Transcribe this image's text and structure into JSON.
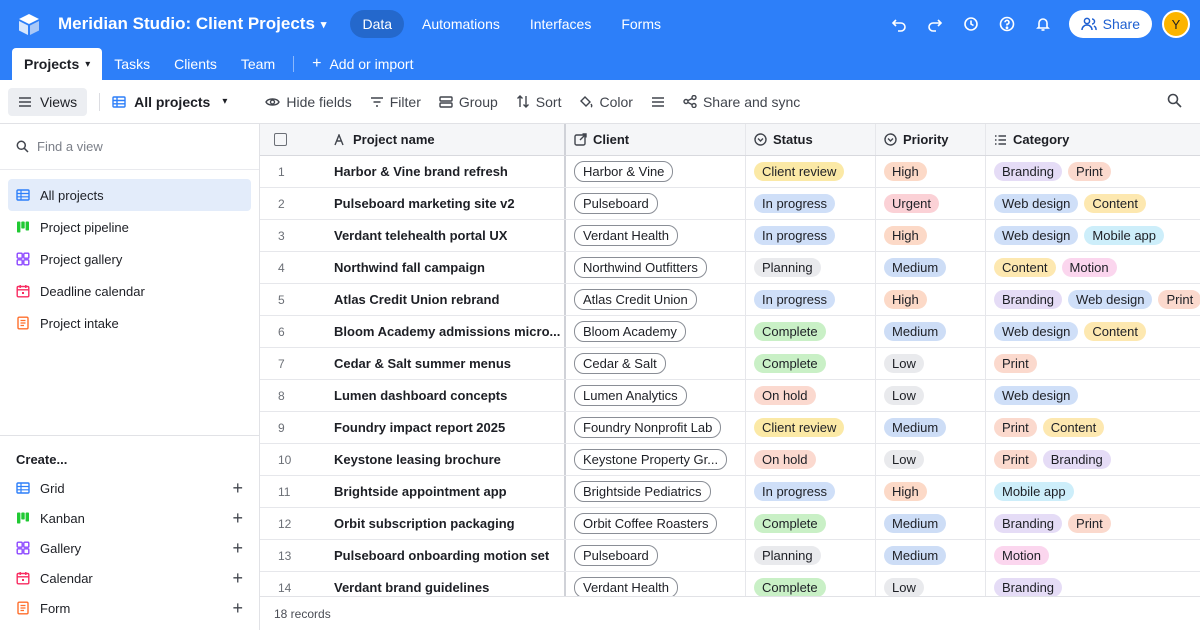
{
  "app": {
    "base_title": "Meridian Studio: Client Projects",
    "nav": [
      "Data",
      "Automations",
      "Interfaces",
      "Forms"
    ],
    "share_label": "Share",
    "avatar_initial": "Y",
    "brand_color": "#2d7ff9"
  },
  "tables": {
    "items": [
      "Projects",
      "Tasks",
      "Clients",
      "Team"
    ],
    "add_label": "Add or import"
  },
  "viewbar": {
    "views_label": "Views",
    "current_view": "All projects",
    "tools": [
      "Hide fields",
      "Filter",
      "Group",
      "Sort",
      "Color",
      "Share and sync"
    ]
  },
  "sidebar": {
    "find_placeholder": "Find a view",
    "views": [
      {
        "label": "All projects",
        "icon": "grid-view-icon"
      },
      {
        "label": "Project pipeline",
        "icon": "kanban-view-icon"
      },
      {
        "label": "Project gallery",
        "icon": "gallery-view-icon"
      },
      {
        "label": "Deadline calendar",
        "icon": "calendar-view-icon"
      },
      {
        "label": "Project intake",
        "icon": "form-view-icon"
      }
    ],
    "create_title": "Create...",
    "create_items": [
      {
        "label": "Grid",
        "icon": "grid-view-icon"
      },
      {
        "label": "Kanban",
        "icon": "kanban-view-icon"
      },
      {
        "label": "Gallery",
        "icon": "gallery-view-icon"
      },
      {
        "label": "Calendar",
        "icon": "calendar-view-icon"
      },
      {
        "label": "Form",
        "icon": "form-view-icon"
      }
    ]
  },
  "grid": {
    "columns": [
      "Project name",
      "Client",
      "Status",
      "Priority",
      "Category"
    ],
    "rows": [
      {
        "n": "1",
        "name": "Harbor & Vine brand refresh",
        "client": "Harbor & Vine",
        "status": "Client review",
        "priority": "High",
        "categories": [
          "Branding",
          "Print"
        ]
      },
      {
        "n": "2",
        "name": "Pulseboard marketing site v2",
        "client": "Pulseboard",
        "status": "In progress",
        "priority": "Urgent",
        "categories": [
          "Web design",
          "Content"
        ]
      },
      {
        "n": "3",
        "name": "Verdant telehealth portal UX",
        "client": "Verdant Health",
        "status": "In progress",
        "priority": "High",
        "categories": [
          "Web design",
          "Mobile app"
        ]
      },
      {
        "n": "4",
        "name": "Northwind fall campaign",
        "client": "Northwind Outfitters",
        "status": "Planning",
        "priority": "Medium",
        "categories": [
          "Content",
          "Motion"
        ]
      },
      {
        "n": "5",
        "name": "Atlas Credit Union rebrand",
        "client": "Atlas Credit Union",
        "status": "In progress",
        "priority": "High",
        "categories": [
          "Branding",
          "Web design",
          "Print"
        ]
      },
      {
        "n": "6",
        "name": "Bloom Academy admissions micro...",
        "client": "Bloom Academy",
        "status": "Complete",
        "priority": "Medium",
        "categories": [
          "Web design",
          "Content"
        ]
      },
      {
        "n": "7",
        "name": "Cedar & Salt summer menus",
        "client": "Cedar & Salt",
        "status": "Complete",
        "priority": "Low",
        "categories": [
          "Print"
        ]
      },
      {
        "n": "8",
        "name": "Lumen dashboard concepts",
        "client": "Lumen Analytics",
        "status": "On hold",
        "priority": "Low",
        "categories": [
          "Web design"
        ]
      },
      {
        "n": "9",
        "name": "Foundry impact report 2025",
        "client": "Foundry Nonprofit Lab",
        "status": "Client review",
        "priority": "Medium",
        "categories": [
          "Print",
          "Content"
        ]
      },
      {
        "n": "10",
        "name": "Keystone leasing brochure",
        "client": "Keystone Property Gr...",
        "status": "On hold",
        "priority": "Low",
        "categories": [
          "Print",
          "Branding"
        ]
      },
      {
        "n": "11",
        "name": "Brightside appointment app",
        "client": "Brightside Pediatrics",
        "status": "In progress",
        "priority": "High",
        "categories": [
          "Mobile app"
        ]
      },
      {
        "n": "12",
        "name": "Orbit subscription packaging",
        "client": "Orbit Coffee Roasters",
        "status": "Complete",
        "priority": "Medium",
        "categories": [
          "Branding",
          "Print"
        ]
      },
      {
        "n": "13",
        "name": "Pulseboard onboarding motion set",
        "client": "Pulseboard",
        "status": "Planning",
        "priority": "Medium",
        "categories": [
          "Motion"
        ]
      },
      {
        "n": "14",
        "name": "Verdant brand guidelines",
        "client": "Verdant Health",
        "status": "Complete",
        "priority": "Low",
        "categories": [
          "Branding"
        ]
      }
    ],
    "record_count": "18 records"
  },
  "colors": {
    "status": {
      "Client review": "#fbe9a6",
      "In progress": "#cfdff8",
      "Planning": "#e9eaed",
      "Complete": "#c9f0c6",
      "On hold": "#fbd9cf"
    },
    "priority": {
      "High": "#fcd9c7",
      "Urgent": "#fbd1d6",
      "Medium": "#cdddf6",
      "Low": "#e9eaed"
    },
    "category": {
      "Branding": "#e5dcf6",
      "Print": "#fbd9cd",
      "Web design": "#cfdff8",
      "Content": "#fde8b0",
      "Mobile app": "#cdeefa",
      "Motion": "#fbd6ee"
    }
  }
}
